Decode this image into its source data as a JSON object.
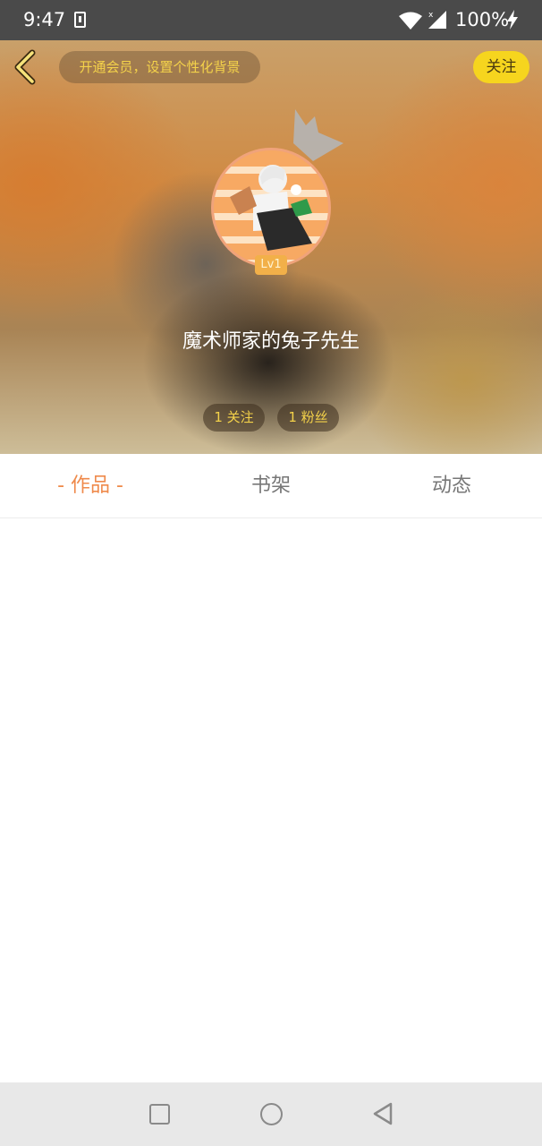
{
  "status_bar": {
    "time": "9:47",
    "battery": "100%",
    "icons": [
      "download-icon",
      "wifi-icon",
      "signal-icon",
      "charging-icon"
    ]
  },
  "header": {
    "vip_banner": "开通会员，设置个性化背景",
    "follow_label": "关注",
    "level": "Lv1",
    "username": "魔术师家的兔子先生",
    "following_count": "1 关注",
    "fans_count": "1 粉丝",
    "accent_color": "#f6d51e"
  },
  "tabs": [
    {
      "label": "- 作品 -",
      "active": true
    },
    {
      "label": "书架",
      "active": false
    },
    {
      "label": "动态",
      "active": false
    }
  ],
  "colors": {
    "active_tab": "#ef8a4b",
    "inactive_tab": "#777777",
    "status_bar": "#4a4a4a",
    "nav_bar": "#e8e8e8"
  },
  "nav_bar": {
    "icons": [
      "recent-apps-icon",
      "home-icon",
      "back-triangle-icon"
    ]
  }
}
